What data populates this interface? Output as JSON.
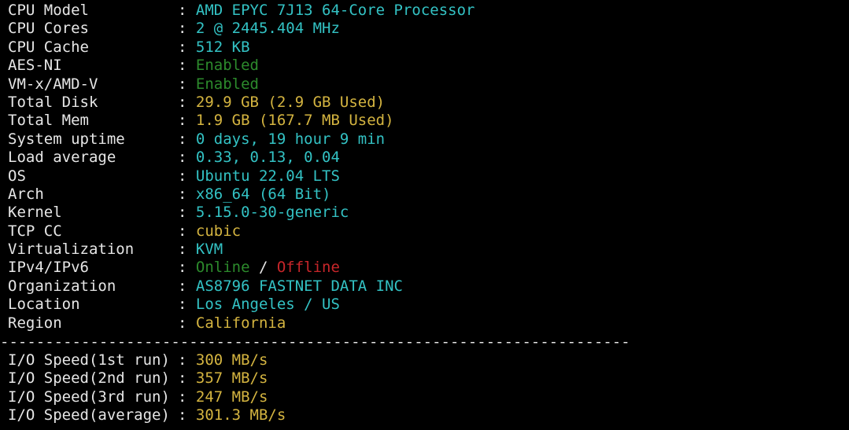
{
  "colors": {
    "background": "#000000",
    "label": "#e6e6e6",
    "cyan": "#33c2c4",
    "green": "#2c8a2c",
    "yellow": "#d4b440",
    "red": "#c8262a"
  },
  "info": [
    {
      "key": "CPU Model",
      "value": "AMD EPYC 7J13 64-Core Processor",
      "color": "cyan"
    },
    {
      "key": "CPU Cores",
      "value": "2 @ 2445.404 MHz",
      "color": "cyan"
    },
    {
      "key": "CPU Cache",
      "value": "512 KB",
      "color": "cyan"
    },
    {
      "key": "AES-NI",
      "value": "Enabled",
      "color": "green"
    },
    {
      "key": "VM-x/AMD-V",
      "value": "Enabled",
      "color": "green"
    },
    {
      "key": "Total Disk",
      "value": "29.9 GB (2.9 GB Used)",
      "color": "yellow"
    },
    {
      "key": "Total Mem",
      "value": "1.9 GB (167.7 MB Used)",
      "color": "yellow"
    },
    {
      "key": "System uptime",
      "value": "0 days, 19 hour 9 min",
      "color": "cyan"
    },
    {
      "key": "Load average",
      "value": "0.33, 0.13, 0.04",
      "color": "cyan"
    },
    {
      "key": "OS",
      "value": "Ubuntu 22.04 LTS",
      "color": "cyan"
    },
    {
      "key": "Arch",
      "value": "x86_64 (64 Bit)",
      "color": "cyan"
    },
    {
      "key": "Kernel",
      "value": "5.15.0-30-generic",
      "color": "cyan"
    },
    {
      "key": "TCP CC",
      "value": "cubic",
      "color": "yellow"
    },
    {
      "key": "Virtualization",
      "value": "KVM",
      "color": "cyan"
    }
  ],
  "ip": {
    "key": "IPv4/IPv6",
    "online": "Online",
    "slash": " / ",
    "offline": "Offline"
  },
  "info2": [
    {
      "key": "Organization",
      "value": "AS8796 FASTNET DATA INC",
      "color": "cyan"
    },
    {
      "key": "Location",
      "value": "Los Angeles / US",
      "color": "cyan"
    },
    {
      "key": "Region",
      "value": "California",
      "color": "yellow"
    }
  ],
  "separator": "----------------------------------------------------------------------",
  "io": [
    {
      "key": "I/O Speed(1st run)",
      "value": "300 MB/s"
    },
    {
      "key": "I/O Speed(2nd run)",
      "value": "357 MB/s"
    },
    {
      "key": "I/O Speed(3rd run)",
      "value": "247 MB/s"
    },
    {
      "key": "I/O Speed(average)",
      "value": "301.3 MB/s"
    }
  ],
  "colon": ": "
}
